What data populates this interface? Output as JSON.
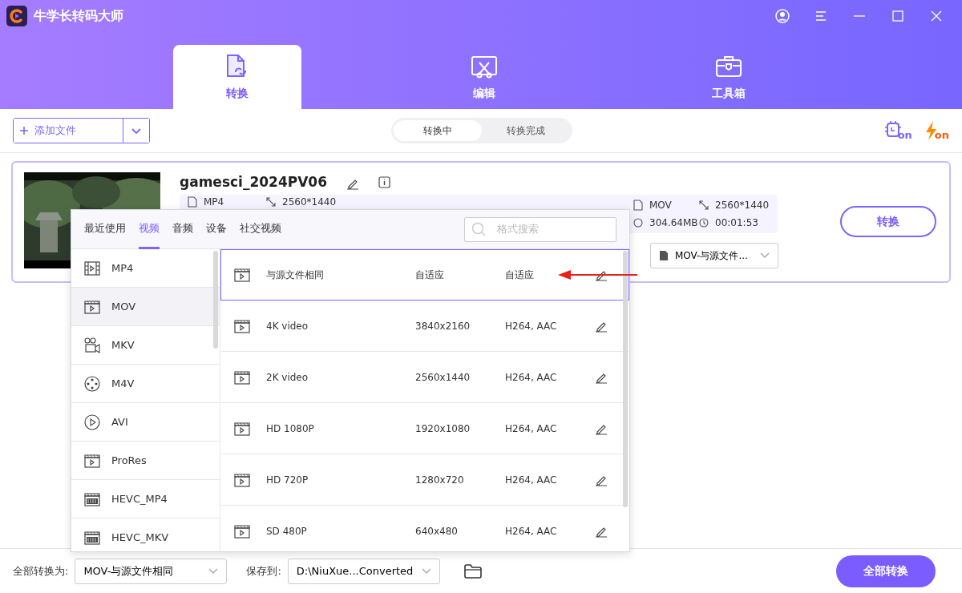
{
  "window": {
    "title": "牛学长转码大师"
  },
  "main_tabs": [
    {
      "label": "转换",
      "kind": "convert",
      "selected": true
    },
    {
      "label": "编辑",
      "kind": "edit",
      "selected": false
    },
    {
      "label": "工具箱",
      "kind": "toolbox",
      "selected": false
    }
  ],
  "toolbar": {
    "add_button": "添加文件",
    "segments": [
      {
        "label": "转换中",
        "selected": true
      },
      {
        "label": "转换完成",
        "selected": false
      }
    ],
    "badges": [
      {
        "kind": "chip",
        "text": "on"
      },
      {
        "kind": "bolt",
        "text": "on"
      }
    ]
  },
  "file": {
    "name": "gamesci_2024PV06",
    "source": {
      "format": "MP4",
      "resolution": "2560*1440"
    },
    "target": {
      "format": "MOV",
      "resolution": "2560*1440",
      "size": "304.64MB",
      "duration": "00:01:53"
    },
    "format_select": "MOV-与源文件...",
    "convert_button": "转换"
  },
  "format_panel": {
    "tabs": [
      {
        "label": "最近使用",
        "selected": false
      },
      {
        "label": "视频",
        "selected": true
      },
      {
        "label": "音频",
        "selected": false
      },
      {
        "label": "设备",
        "selected": false
      },
      {
        "label": "社交视频",
        "selected": false
      }
    ],
    "search": {
      "placeholder": "格式搜索"
    },
    "formats": [
      {
        "label": "MP4",
        "kind": "film",
        "selected": false
      },
      {
        "label": "MOV",
        "kind": "clapper",
        "selected": true
      },
      {
        "label": "MKV",
        "kind": "camera",
        "selected": false
      },
      {
        "label": "M4V",
        "kind": "reel",
        "selected": false
      },
      {
        "label": "AVI",
        "kind": "play",
        "selected": false
      },
      {
        "label": "ProRes",
        "kind": "clapper",
        "selected": false
      },
      {
        "label": "HEVC_MP4",
        "kind": "hevc",
        "selected": false
      },
      {
        "label": "HEVC_MKV",
        "kind": "hevc",
        "selected": false
      }
    ],
    "presets": [
      {
        "name": "与源文件相同",
        "resolution": "自适应",
        "codec": "自适应",
        "selected": true
      },
      {
        "name": "4K video",
        "resolution": "3840x2160",
        "codec": "H264, AAC",
        "selected": false
      },
      {
        "name": "2K video",
        "resolution": "2560x1440",
        "codec": "H264, AAC",
        "selected": false
      },
      {
        "name": "HD 1080P",
        "resolution": "1920x1080",
        "codec": "H264, AAC",
        "selected": false
      },
      {
        "name": "HD 720P",
        "resolution": "1280x720",
        "codec": "H264, AAC",
        "selected": false
      },
      {
        "name": "SD 480P",
        "resolution": "640x480",
        "codec": "H264, AAC",
        "selected": false
      }
    ]
  },
  "bottom_bar": {
    "convert_all_label": "全部转换为:",
    "convert_all_value": "MOV-与源文件相同",
    "save_label": "保存到:",
    "save_value": "D:\\NiuXue...Converted",
    "convert_all_button": "全部转换"
  }
}
